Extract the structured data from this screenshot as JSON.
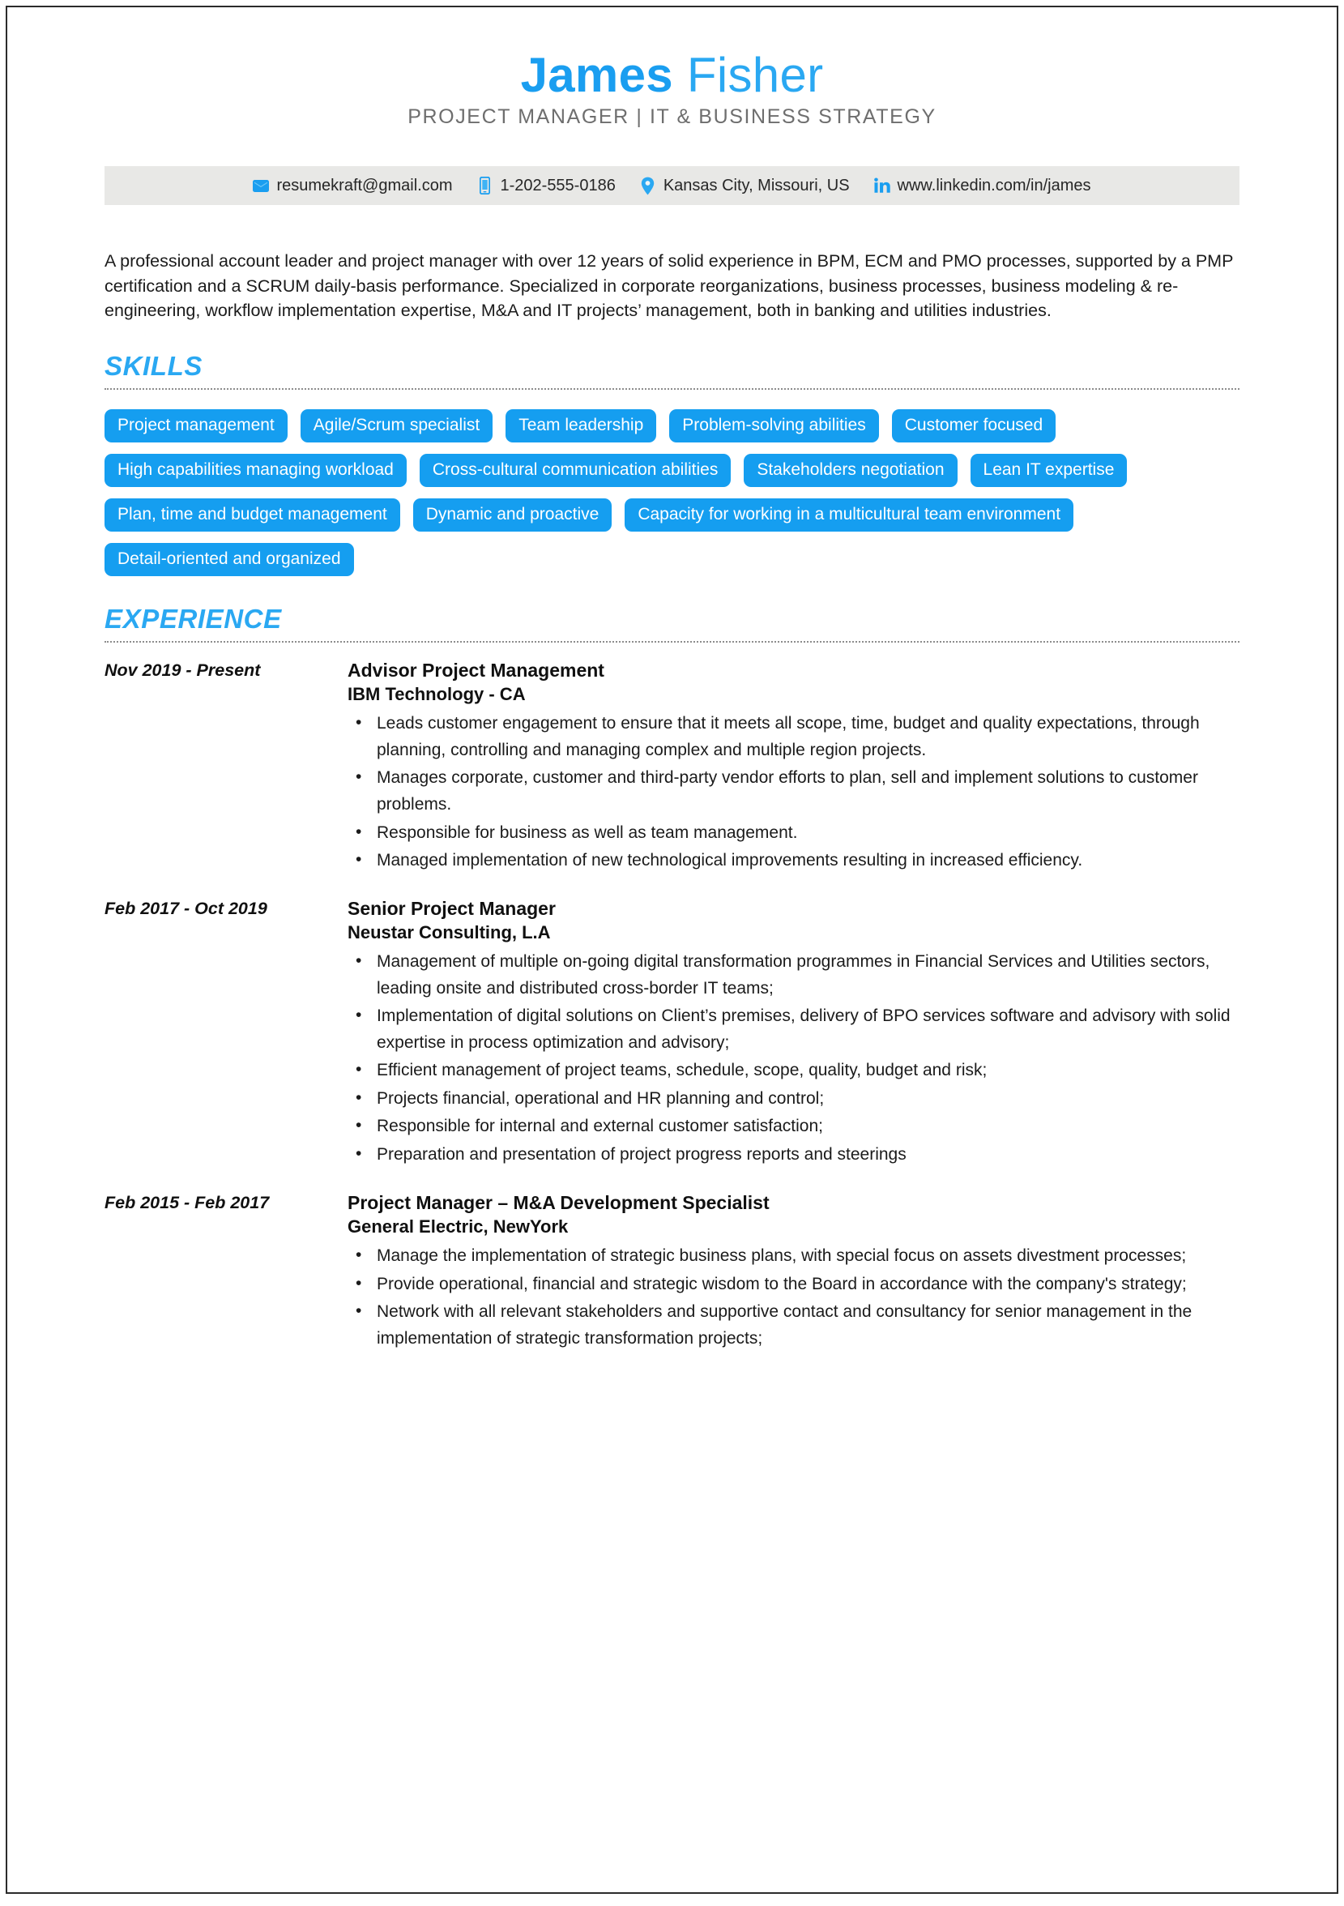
{
  "header": {
    "first_name": "James",
    "last_name": "Fisher",
    "headline": "PROJECT MANAGER | IT & BUSINESS STRATEGY"
  },
  "contact": {
    "items": [
      {
        "icon": "email-icon",
        "text": "resumekraft@gmail.com"
      },
      {
        "icon": "phone-icon",
        "text": "1-202-555-0186"
      },
      {
        "icon": "location-pin-icon",
        "text": "Kansas City, Missouri, US"
      },
      {
        "icon": "linkedin-icon",
        "text": "www.linkedin.com/in/james"
      }
    ]
  },
  "summary": {
    "text": "A professional account leader and project manager with over 12 years of solid experience in BPM, ECM and PMO processes, supported by a PMP certification and a SCRUM daily-basis performance. Specialized in corporate reorganizations, business processes, business modeling & re-engineering, workflow implementation expertise, M&A and IT projects’ management, both in banking and utilities industries."
  },
  "skills": {
    "title": "SKILLS",
    "items": [
      "Project management",
      "Agile/Scrum specialist",
      "Team leadership",
      "Problem-solving abilities",
      "Customer focused",
      "High capabilities managing workload",
      "Cross-cultural communication abilities",
      "Stakeholders negotiation",
      "Lean IT expertise",
      "Plan, time and budget management",
      "Dynamic and proactive",
      "Capacity for working in a multicultural team environment",
      "Detail-oriented and organized"
    ]
  },
  "experience": {
    "title": "EXPERIENCE",
    "entries": [
      {
        "date": "Nov 2019 - Present",
        "role": "Advisor Project Management",
        "company": "IBM Technology - CA",
        "bullets": [
          "Leads customer engagement to ensure that it meets all scope, time, budget and quality expectations, through planning, controlling and managing complex and multiple region projects.",
          "Manages corporate, customer and third-party vendor efforts to plan, sell and implement solutions to customer problems.",
          "Responsible for business as well as team management.",
          "Managed implementation of new technological improvements resulting in increased efficiency."
        ]
      },
      {
        "date": "Feb 2017 - Oct 2019",
        "role": "Senior Project Manager",
        "company": "Neustar Consulting, L.A",
        "bullets": [
          "Management of multiple on-going digital transformation programmes in Financial Services and Utilities sectors, leading onsite and distributed cross-border IT teams;",
          "Implementation of digital solutions on Client’s premises, delivery of BPO services software and advisory with solid expertise in process optimization and advisory;",
          "Efficient management of project teams, schedule, scope, quality, budget and risk;",
          "Projects financial, operational and HR planning and control;",
          "Responsible for internal and external customer satisfaction;",
          "Preparation and presentation of project progress reports and steerings"
        ]
      },
      {
        "date": "Feb 2015 - Feb 2017",
        "role": "Project Manager – M&A Development Specialist",
        "company": "General Electric, NewYork",
        "bullets": [
          "Manage the implementation of strategic business plans, with special focus on assets divestment processes;",
          "Provide operational, financial and strategic wisdom to the Board in accordance with the company's strategy;",
          "Network with all relevant stakeholders and supportive contact and consultancy for senior management in the implementation of strategic transformation projects;"
        ]
      }
    ]
  },
  "colors": {
    "accent_blue": "#2aa8f2",
    "pill_blue": "#159ef0",
    "contact_bar_bg": "#e8e8e6",
    "headline_gray": "#6e6e6e",
    "body_text": "#1b1b1b"
  }
}
